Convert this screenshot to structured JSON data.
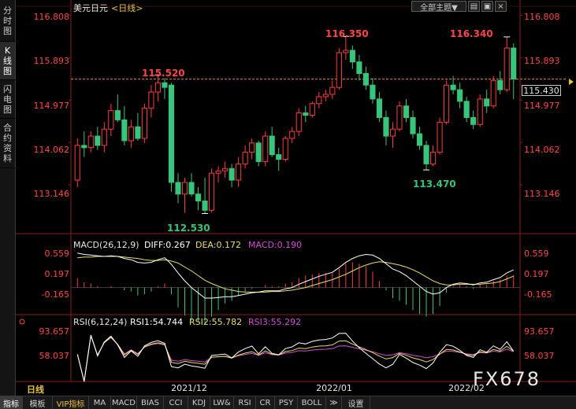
{
  "sidebar": {
    "tabs": [
      {
        "label": "分时图",
        "chars": [
          "分",
          "时",
          "图"
        ],
        "active": false
      },
      {
        "label": "K线图",
        "chars": [
          "K",
          "线",
          "图"
        ],
        "active": true
      },
      {
        "label": "闪电图",
        "chars": [
          "闪",
          "电",
          "图"
        ],
        "active": false
      },
      {
        "label": "合约资料",
        "chars": [
          "合",
          "约",
          "资",
          "料"
        ],
        "active": false
      }
    ]
  },
  "header": {
    "symbol": "美元日元",
    "period": "<日线>",
    "theme_button": "全部主题▼"
  },
  "price_axis": {
    "ticks": [
      "116.808",
      "115.893",
      "114.977",
      "114.062",
      "113.146"
    ],
    "current_price": "115.430"
  },
  "annotations": {
    "high1": "115.520",
    "high2": "116.350",
    "high3": "116.340",
    "low1": "112.530",
    "low2": "113.470"
  },
  "macd": {
    "label": "MACD(26,12,9)",
    "diff": "DIFF:0.267",
    "dea": "DEA:0.172",
    "macd": "MACD:0.190",
    "ticks": [
      "0.559",
      "0.197",
      "-0.165"
    ]
  },
  "rsi": {
    "label": "RSI(6,12,24)",
    "rsi1": "RSI1:54.744",
    "rsi2": "RSI2:55.782",
    "rsi3": "RSI3:55.292",
    "ticks": [
      "93.657",
      "58.037"
    ]
  },
  "time_axis": [
    "2021/12",
    "2022/01",
    "2022/02"
  ],
  "period_label": "日线",
  "watermark": "FX678",
  "bottom_tabs": [
    {
      "label": "指标",
      "active": true,
      "vip": false
    },
    {
      "label": "模板",
      "active": false,
      "vip": false
    },
    {
      "label": "VIP指标",
      "active": false,
      "vip": true
    },
    {
      "label": "MA",
      "active": false,
      "vip": false
    },
    {
      "label": "MACD",
      "active": false,
      "vip": false
    },
    {
      "label": "BIAS",
      "active": false,
      "vip": false
    },
    {
      "label": "CCI",
      "active": false,
      "vip": false
    },
    {
      "label": "KDJ",
      "active": false,
      "vip": false
    },
    {
      "label": "LW&",
      "active": false,
      "vip": false
    },
    {
      "label": "RSI",
      "active": false,
      "vip": false
    },
    {
      "label": "CR",
      "active": false,
      "vip": false
    },
    {
      "label": "PSY",
      "active": false,
      "vip": false
    },
    {
      "label": "BOLL",
      "active": false,
      "vip": false
    },
    {
      "label": "≫",
      "active": false,
      "vip": false
    },
    {
      "label": "设置",
      "active": false,
      "vip": false
    }
  ],
  "colors": {
    "up": "#ff3b3b",
    "down": "#36c57a",
    "diff": "#ffffff",
    "dea": "#e8e05a",
    "macd": "#d84bd8",
    "rsi1": "#ffffff",
    "rsi2": "#e8e05a",
    "rsi3": "#d84bd8",
    "grid": "#7a1a1a",
    "axis_red": "#ff4444",
    "accent": "#e8c23a"
  },
  "chart_data": {
    "type": "candlestick",
    "title": "美元日元 <日线>",
    "ylim": [
      112.3,
      117.0
    ],
    "x_ticks": [
      "2021/12",
      "2022/01",
      "2022/02"
    ],
    "candles": [
      {
        "o": 113.25,
        "h": 114.15,
        "l": 113.1,
        "c": 114.0
      },
      {
        "o": 114.0,
        "h": 114.3,
        "l": 113.75,
        "c": 113.95
      },
      {
        "o": 113.95,
        "h": 114.3,
        "l": 113.85,
        "c": 114.2
      },
      {
        "o": 114.2,
        "h": 114.4,
        "l": 113.9,
        "c": 114.0
      },
      {
        "o": 114.0,
        "h": 114.5,
        "l": 113.85,
        "c": 114.35
      },
      {
        "o": 114.35,
        "h": 114.9,
        "l": 114.2,
        "c": 114.75
      },
      {
        "o": 114.75,
        "h": 115.1,
        "l": 114.5,
        "c": 114.55
      },
      {
        "o": 114.55,
        "h": 114.85,
        "l": 114.0,
        "c": 114.1
      },
      {
        "o": 114.1,
        "h": 114.55,
        "l": 113.95,
        "c": 114.4
      },
      {
        "o": 114.4,
        "h": 114.7,
        "l": 114.1,
        "c": 114.15
      },
      {
        "o": 114.15,
        "h": 114.9,
        "l": 114.05,
        "c": 114.8
      },
      {
        "o": 114.8,
        "h": 115.3,
        "l": 114.6,
        "c": 115.15
      },
      {
        "o": 115.15,
        "h": 115.52,
        "l": 114.95,
        "c": 115.35
      },
      {
        "o": 115.35,
        "h": 115.45,
        "l": 115.0,
        "c": 115.25
      },
      {
        "o": 115.3,
        "h": 115.35,
        "l": 113.0,
        "c": 113.2
      },
      {
        "o": 113.2,
        "h": 113.4,
        "l": 112.75,
        "c": 112.95
      },
      {
        "o": 112.95,
        "h": 113.3,
        "l": 112.55,
        "c": 113.2
      },
      {
        "o": 113.2,
        "h": 113.4,
        "l": 112.9,
        "c": 112.95
      },
      {
        "o": 112.95,
        "h": 113.1,
        "l": 112.6,
        "c": 112.8
      },
      {
        "o": 112.8,
        "h": 113.3,
        "l": 112.53,
        "c": 112.6
      },
      {
        "o": 112.6,
        "h": 113.5,
        "l": 112.55,
        "c": 113.4
      },
      {
        "o": 113.4,
        "h": 113.55,
        "l": 113.2,
        "c": 113.45
      },
      {
        "o": 113.45,
        "h": 113.65,
        "l": 113.3,
        "c": 113.5
      },
      {
        "o": 113.5,
        "h": 113.6,
        "l": 113.1,
        "c": 113.25
      },
      {
        "o": 113.25,
        "h": 113.75,
        "l": 113.1,
        "c": 113.6
      },
      {
        "o": 113.6,
        "h": 114.0,
        "l": 113.5,
        "c": 113.85
      },
      {
        "o": 113.85,
        "h": 114.15,
        "l": 113.7,
        "c": 114.05
      },
      {
        "o": 114.05,
        "h": 114.1,
        "l": 113.55,
        "c": 113.65
      },
      {
        "o": 113.65,
        "h": 114.3,
        "l": 113.55,
        "c": 114.2
      },
      {
        "o": 114.2,
        "h": 114.4,
        "l": 113.75,
        "c": 113.8
      },
      {
        "o": 113.8,
        "h": 113.95,
        "l": 113.45,
        "c": 113.7
      },
      {
        "o": 113.7,
        "h": 114.2,
        "l": 113.65,
        "c": 114.15
      },
      {
        "o": 114.15,
        "h": 114.4,
        "l": 114.05,
        "c": 114.3
      },
      {
        "o": 114.3,
        "h": 114.8,
        "l": 114.2,
        "c": 114.7
      },
      {
        "o": 114.7,
        "h": 114.85,
        "l": 114.5,
        "c": 114.65
      },
      {
        "o": 114.65,
        "h": 114.95,
        "l": 114.6,
        "c": 114.9
      },
      {
        "o": 114.9,
        "h": 115.15,
        "l": 114.8,
        "c": 115.05
      },
      {
        "o": 115.05,
        "h": 115.2,
        "l": 114.95,
        "c": 115.1
      },
      {
        "o": 115.1,
        "h": 115.4,
        "l": 115.0,
        "c": 115.25
      },
      {
        "o": 115.25,
        "h": 116.1,
        "l": 115.2,
        "c": 116.0
      },
      {
        "o": 116.0,
        "h": 116.35,
        "l": 115.85,
        "c": 116.05
      },
      {
        "o": 116.05,
        "h": 116.15,
        "l": 115.65,
        "c": 115.8
      },
      {
        "o": 115.8,
        "h": 115.95,
        "l": 115.4,
        "c": 115.55
      },
      {
        "o": 115.55,
        "h": 115.7,
        "l": 115.2,
        "c": 115.3
      },
      {
        "o": 115.3,
        "h": 115.45,
        "l": 114.9,
        "c": 115.0
      },
      {
        "o": 115.0,
        "h": 115.15,
        "l": 114.5,
        "c": 114.6
      },
      {
        "o": 114.6,
        "h": 114.75,
        "l": 114.0,
        "c": 114.2
      },
      {
        "o": 114.2,
        "h": 114.5,
        "l": 113.95,
        "c": 114.35
      },
      {
        "o": 114.35,
        "h": 114.95,
        "l": 114.3,
        "c": 114.85
      },
      {
        "o": 114.85,
        "h": 115.0,
        "l": 114.5,
        "c": 114.6
      },
      {
        "o": 114.6,
        "h": 114.75,
        "l": 114.15,
        "c": 114.25
      },
      {
        "o": 114.25,
        "h": 114.4,
        "l": 113.9,
        "c": 114.0
      },
      {
        "o": 114.0,
        "h": 114.1,
        "l": 113.47,
        "c": 113.6
      },
      {
        "o": 113.6,
        "h": 114.0,
        "l": 113.55,
        "c": 113.85
      },
      {
        "o": 113.85,
        "h": 114.6,
        "l": 113.8,
        "c": 114.5
      },
      {
        "o": 114.5,
        "h": 115.4,
        "l": 114.45,
        "c": 115.3
      },
      {
        "o": 115.3,
        "h": 115.5,
        "l": 115.1,
        "c": 115.2
      },
      {
        "o": 115.2,
        "h": 115.35,
        "l": 114.8,
        "c": 114.95
      },
      {
        "o": 114.95,
        "h": 115.05,
        "l": 114.5,
        "c": 114.6
      },
      {
        "o": 114.6,
        "h": 114.75,
        "l": 114.35,
        "c": 114.45
      },
      {
        "o": 114.45,
        "h": 115.1,
        "l": 114.4,
        "c": 115.0
      },
      {
        "o": 115.0,
        "h": 115.2,
        "l": 114.7,
        "c": 114.85
      },
      {
        "o": 114.85,
        "h": 115.5,
        "l": 114.8,
        "c": 115.4
      },
      {
        "o": 115.4,
        "h": 115.6,
        "l": 115.1,
        "c": 115.2
      },
      {
        "o": 115.2,
        "h": 116.34,
        "l": 115.15,
        "c": 116.1
      },
      {
        "o": 116.1,
        "h": 116.2,
        "l": 115.0,
        "c": 115.43
      }
    ],
    "reference_price": 115.43,
    "macd_ylim": [
      -0.35,
      0.72
    ],
    "macd_diff": [
      0.52,
      0.5,
      0.49,
      0.48,
      0.47,
      0.48,
      0.47,
      0.44,
      0.42,
      0.38,
      0.37,
      0.38,
      0.42,
      0.45,
      0.35,
      0.22,
      0.1,
      0.0,
      -0.08,
      -0.16,
      -0.16,
      -0.15,
      -0.14,
      -0.14,
      -0.12,
      -0.1,
      -0.08,
      -0.07,
      -0.05,
      -0.05,
      -0.05,
      -0.02,
      0.0,
      0.05,
      0.09,
      0.13,
      0.17,
      0.2,
      0.23,
      0.3,
      0.38,
      0.44,
      0.48,
      0.5,
      0.49,
      0.44,
      0.36,
      0.28,
      0.24,
      0.18,
      0.1,
      0.02,
      -0.06,
      -0.1,
      -0.08,
      0.0,
      0.05,
      0.07,
      0.06,
      0.04,
      0.07,
      0.08,
      0.12,
      0.15,
      0.22,
      0.267
    ],
    "macd_dea": [
      0.45,
      0.46,
      0.46,
      0.47,
      0.47,
      0.47,
      0.47,
      0.46,
      0.45,
      0.44,
      0.42,
      0.41,
      0.41,
      0.42,
      0.4,
      0.37,
      0.31,
      0.25,
      0.18,
      0.11,
      0.06,
      0.02,
      -0.02,
      -0.04,
      -0.06,
      -0.07,
      -0.07,
      -0.07,
      -0.07,
      -0.06,
      -0.06,
      -0.05,
      -0.04,
      -0.02,
      0.0,
      0.03,
      0.06,
      0.09,
      0.12,
      0.16,
      0.2,
      0.25,
      0.3,
      0.34,
      0.37,
      0.39,
      0.38,
      0.36,
      0.34,
      0.31,
      0.27,
      0.22,
      0.16,
      0.1,
      0.06,
      0.04,
      0.04,
      0.05,
      0.05,
      0.05,
      0.05,
      0.06,
      0.07,
      0.09,
      0.13,
      0.172
    ]
  }
}
